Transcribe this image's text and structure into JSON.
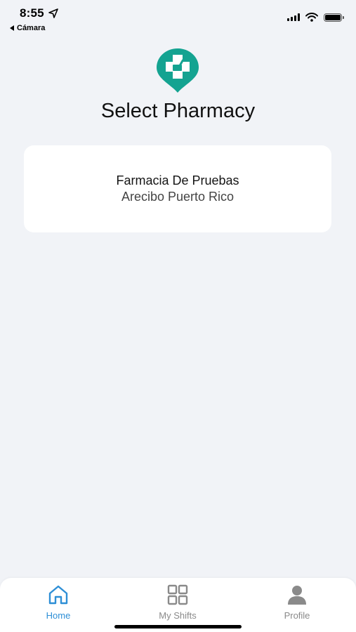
{
  "status_bar": {
    "time": "8:55",
    "back_app_label": "Cámara",
    "location_icon": "location-arrow",
    "signal_icon": "cellular-signal",
    "wifi_icon": "wifi",
    "battery_icon": "battery-full"
  },
  "header": {
    "logo_icon": "pharmacy-pin-logo",
    "title": "Select Pharmacy"
  },
  "pharmacies": [
    {
      "name": "Farmacia De Pruebas",
      "location": "Arecibo Puerto Rico"
    }
  ],
  "tab_bar": {
    "tabs": [
      {
        "label": "Home",
        "icon": "home-icon",
        "active": true
      },
      {
        "label": "My Shifts",
        "icon": "grid-icon",
        "active": false
      },
      {
        "label": "Profile",
        "icon": "person-icon",
        "active": false
      }
    ]
  },
  "colors": {
    "background": "#f1f3f7",
    "brand_teal": "#14a391",
    "active_tab": "#2e8fd6",
    "inactive_tab": "#8a8a8a",
    "card": "#ffffff"
  }
}
